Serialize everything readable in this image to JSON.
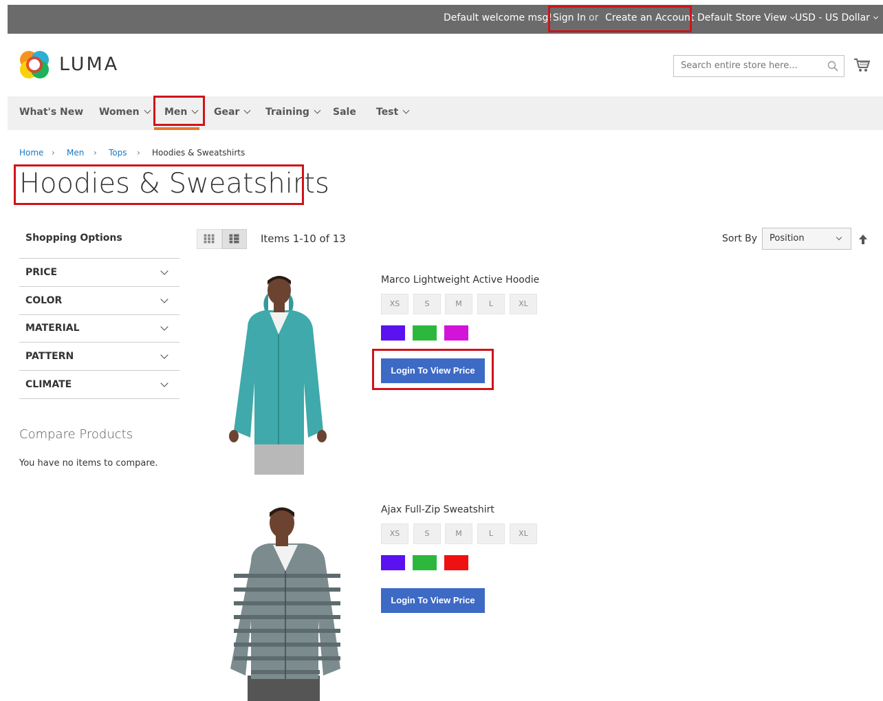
{
  "header": {
    "welcome": "Default welcome msg!",
    "sign_in": "Sign In",
    "or": "or",
    "create_account": "Create an Account",
    "store_view": "Default Store View",
    "currency": "USD - US Dollar"
  },
  "logo": {
    "text": "LUMA"
  },
  "search": {
    "placeholder": "Search entire store here..."
  },
  "nav": {
    "items": [
      {
        "label": "What's New",
        "dropdown": false
      },
      {
        "label": "Women",
        "dropdown": true
      },
      {
        "label": "Men",
        "dropdown": true
      },
      {
        "label": "Gear",
        "dropdown": true
      },
      {
        "label": "Training",
        "dropdown": true
      },
      {
        "label": "Sale",
        "dropdown": false
      },
      {
        "label": "Test",
        "dropdown": true
      }
    ]
  },
  "breadcrumb": [
    "Home",
    "Men",
    "Tops",
    "Hoodies & Sweatshirts"
  ],
  "page": {
    "title": "Hoodies & Sweatshirts"
  },
  "sidebar": {
    "title": "Shopping Options",
    "filters": [
      "PRICE",
      "COLOR",
      "MATERIAL",
      "PATTERN",
      "CLIMATE"
    ],
    "compare_title": "Compare Products",
    "compare_text": "You have no items to compare."
  },
  "toolbar": {
    "items_count": "Items 1-10 of 13",
    "sort_label": "Sort By",
    "sort_value": "Position"
  },
  "products": [
    {
      "name": "Marco Lightweight Active Hoodie",
      "sizes": [
        "XS",
        "S",
        "M",
        "L",
        "XL"
      ],
      "colors": [
        "#5b12f0",
        "#2db83d",
        "#d313d8"
      ],
      "button": "Login To View Price"
    },
    {
      "name": "Ajax Full-Zip Sweatshirt",
      "sizes": [
        "XS",
        "S",
        "M",
        "L",
        "XL"
      ],
      "colors": [
        "#5b12f0",
        "#2db83d",
        "#ef1111"
      ],
      "button": "Login To View Price"
    }
  ],
  "colors": {
    "accent_button": "#3d6ac5",
    "topbar": "#6b6b6b",
    "highlight": "#d0121a"
  }
}
